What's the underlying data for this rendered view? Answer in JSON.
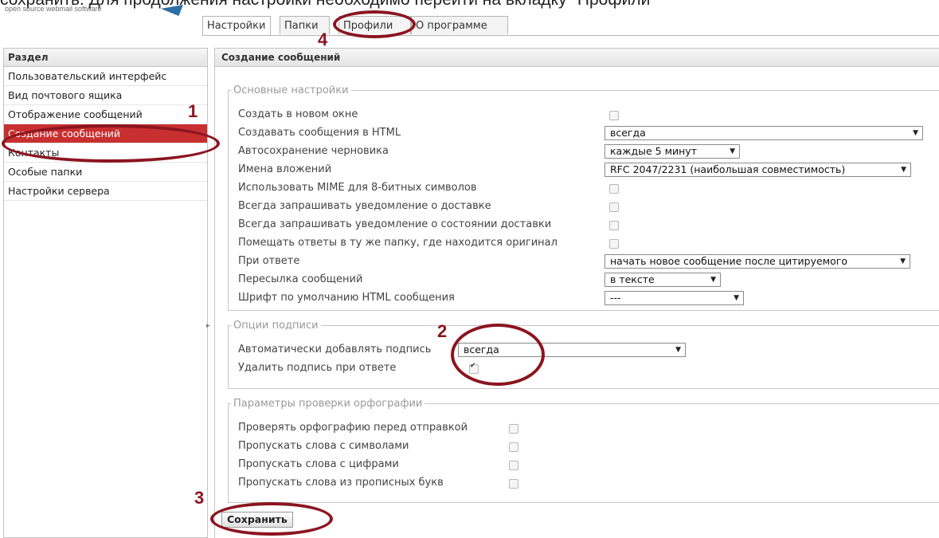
{
  "caption": "сохранить. Для продолжения настройки необходимо перейти на вкладку \"Профили\"",
  "logo": {
    "text": "open source webmail software"
  },
  "tabs": [
    {
      "label": "Настройки",
      "active": true
    },
    {
      "label": "Папки"
    },
    {
      "label": "Профили"
    },
    {
      "label": "О программе"
    }
  ],
  "sidebar": {
    "header": "Раздел",
    "items": [
      "Пользовательский интерфейс",
      "Вид почтового ящика",
      "Отображение сообщений",
      "Создание сообщений",
      "Контакты",
      "Особые папки",
      "Настройки сервера"
    ],
    "selected_index": 3
  },
  "main": {
    "header": "Создание сообщений",
    "basic": {
      "legend": "Основные настройки",
      "rows": [
        {
          "label": "Создать в новом окне",
          "type": "checkbox",
          "checked": false
        },
        {
          "label": "Создавать сообщения в HTML",
          "type": "select",
          "value": "всегда"
        },
        {
          "label": "Автосохранение черновика",
          "type": "select",
          "value": "каждые 5 минут"
        },
        {
          "label": "Имена вложений",
          "type": "select",
          "value": "RFC 2047/2231 (наибольшая совместимость)"
        },
        {
          "label": "Использовать MIME для 8-битных символов",
          "type": "checkbox",
          "checked": false
        },
        {
          "label": "Всегда запрашивать уведомление о доставке",
          "type": "checkbox",
          "checked": false
        },
        {
          "label": "Всегда запрашивать уведомление о состоянии доставки",
          "type": "checkbox",
          "checked": false
        },
        {
          "label": "Помещать ответы в ту же папку, где находится оригинал",
          "type": "checkbox",
          "checked": false
        },
        {
          "label": "При ответе",
          "type": "select",
          "value": "начать новое сообщение после цитируемого"
        },
        {
          "label": "Пересылка сообщений",
          "type": "select",
          "value": "в тексте"
        },
        {
          "label": "Шрифт по умолчанию HTML сообщения",
          "type": "select",
          "value": "---"
        }
      ]
    },
    "signature": {
      "legend": "Опции подписи",
      "rows": [
        {
          "label": "Автоматически добавлять подпись",
          "type": "select",
          "value": "всегда"
        },
        {
          "label": "Удалить подпись при ответе",
          "type": "checkbox",
          "checked": true
        }
      ]
    },
    "spell": {
      "legend": "Параметры проверки орфографии",
      "rows": [
        {
          "label": "Проверять орфографию перед отправкой",
          "type": "checkbox",
          "checked": false
        },
        {
          "label": "Пропускать слова с символами",
          "type": "checkbox",
          "checked": false
        },
        {
          "label": "Пропускать слова с цифрами",
          "type": "checkbox",
          "checked": false
        },
        {
          "label": "Пропускать слова из прописных букв",
          "type": "checkbox",
          "checked": false
        }
      ]
    },
    "save_label": "Сохранить"
  },
  "annotations": {
    "n1": "1",
    "n2": "2",
    "n3": "3",
    "n4": "4",
    "color": "#8b1520"
  },
  "colors": {
    "selected_bg": "#c8302f"
  }
}
